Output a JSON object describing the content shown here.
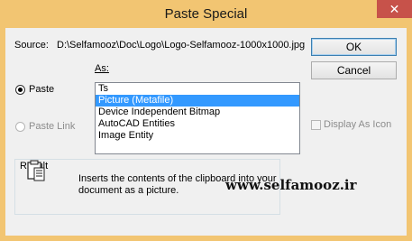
{
  "window": {
    "title": "Paste Special",
    "close_glyph": "✕"
  },
  "source": {
    "label": "Source:",
    "value": "D:\\Selfamooz\\Doc\\Logo\\Logo-Selfamooz-1000x1000.jpg"
  },
  "buttons": {
    "ok": "OK",
    "cancel": "Cancel"
  },
  "as_label": "As:",
  "options": {
    "paste": "Paste",
    "paste_link": "Paste Link",
    "paste_selected": true
  },
  "list": {
    "items": [
      "Ts",
      "Picture (Metafile)",
      "Device Independent Bitmap",
      "AutoCAD Entities",
      "Image Entity"
    ],
    "selected_index": 1
  },
  "display_as_icon": {
    "label": "Display As Icon",
    "checked": false,
    "enabled": false
  },
  "result": {
    "label": "Result",
    "text_line1": "Inserts the contents of the clipboard into your",
    "text_line2": "document as a picture.",
    "icon": "clipboard-icon"
  },
  "watermark": "www.selfamooz.ir",
  "colors": {
    "frame": "#f2c572",
    "close": "#c7524a",
    "selection": "#3399ff",
    "dialog_bg": "#f0f0f0"
  }
}
